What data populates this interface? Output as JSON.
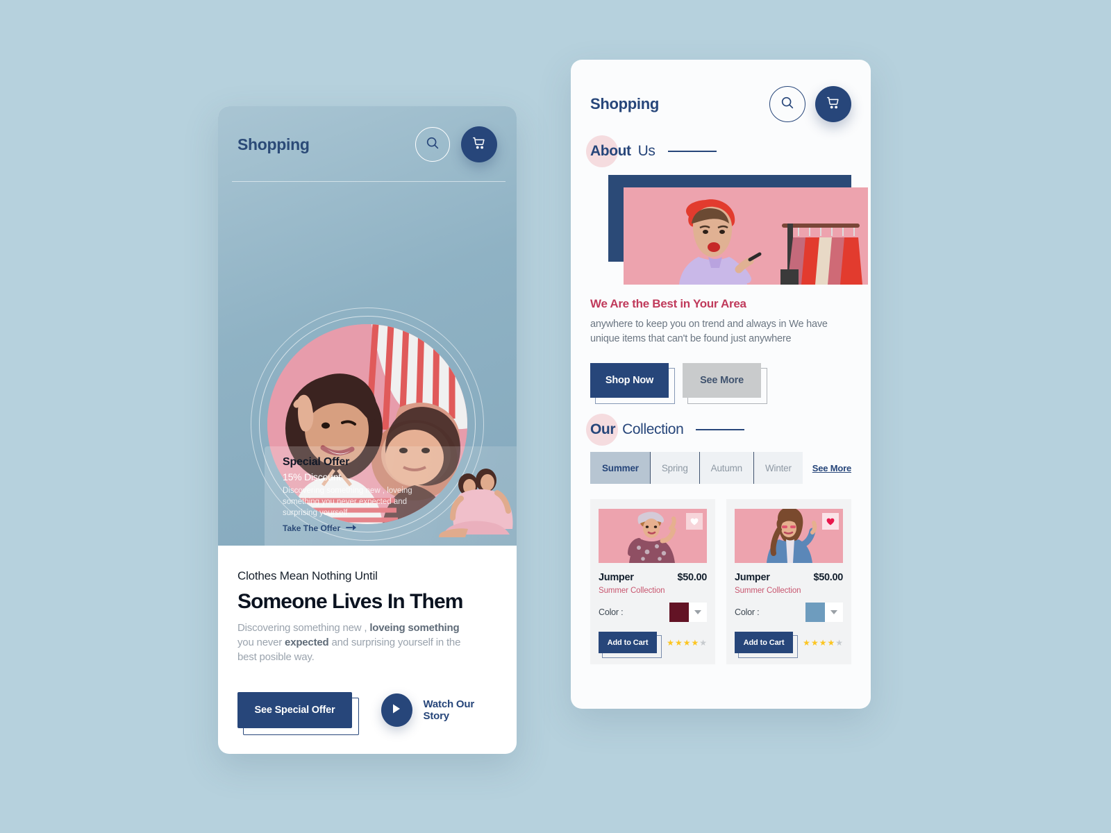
{
  "theme": {
    "page_bg": "#b6d1dd",
    "navy": "#27467a",
    "rose": "#c03a5b",
    "blob_pink": "#f5dcdf"
  },
  "left_panel": {
    "brand": "Shopping",
    "icons": {
      "search": "search-icon",
      "cart": "cart-icon"
    },
    "offer": {
      "title": "Special Offer",
      "subtitle": "15% Discount",
      "description": "Discovering something new , loveing something   you never expected and surprising yourself",
      "link_label": "Take The Offer",
      "link_arrow": "→"
    },
    "eyebrow": "Clothes Mean Nothing Until",
    "headline": "Someone Lives In Them",
    "lede_part1": "Discovering something new , ",
    "lede_bold1": "loveing something",
    "lede_part2": " you never ",
    "lede_bold2": "expected",
    "lede_part3": " and surprising yourself in the best posible way.",
    "primary_button": "See Special Offer",
    "watch_label": "Watch Our Story",
    "play_icon": "play-icon"
  },
  "right_panel": {
    "brand": "Shopping",
    "icons": {
      "search": "search-icon",
      "cart": "cart-icon"
    },
    "about": {
      "heading_strong": "About",
      "heading_light": "Us",
      "title": "We Are the Best in Your Area",
      "copy": "anywhere to keep you on trend and always in We have unique items that can't be found just anywhere",
      "shop_button": "Shop Now",
      "see_more_button": "See More"
    },
    "collection": {
      "heading_strong": "Our",
      "heading_light": "Collection",
      "see_more_link": "See More",
      "tabs": [
        {
          "label": "Summer",
          "active": true
        },
        {
          "label": "Spring",
          "active": false
        },
        {
          "label": "Autumn",
          "active": false
        },
        {
          "label": "Winter",
          "active": false
        }
      ],
      "products": [
        {
          "name": "Jumper",
          "price": "$50.00",
          "collection": "Summer Collection",
          "color_label": "Color :",
          "color_swatch": "#631325",
          "add_to_cart": "Add to Cart",
          "rating_filled": 4,
          "rating_total": 5,
          "favorite": false,
          "favorite_icon": "heart-icon"
        },
        {
          "name": "Jumper",
          "price": "$50.00",
          "collection": "Summer Collection",
          "color_label": "Color :",
          "color_swatch": "#6e9cbe",
          "add_to_cart": "Add to Cart",
          "rating_filled": 4,
          "rating_total": 5,
          "favorite": true,
          "favorite_icon": "heart-icon"
        }
      ]
    }
  }
}
